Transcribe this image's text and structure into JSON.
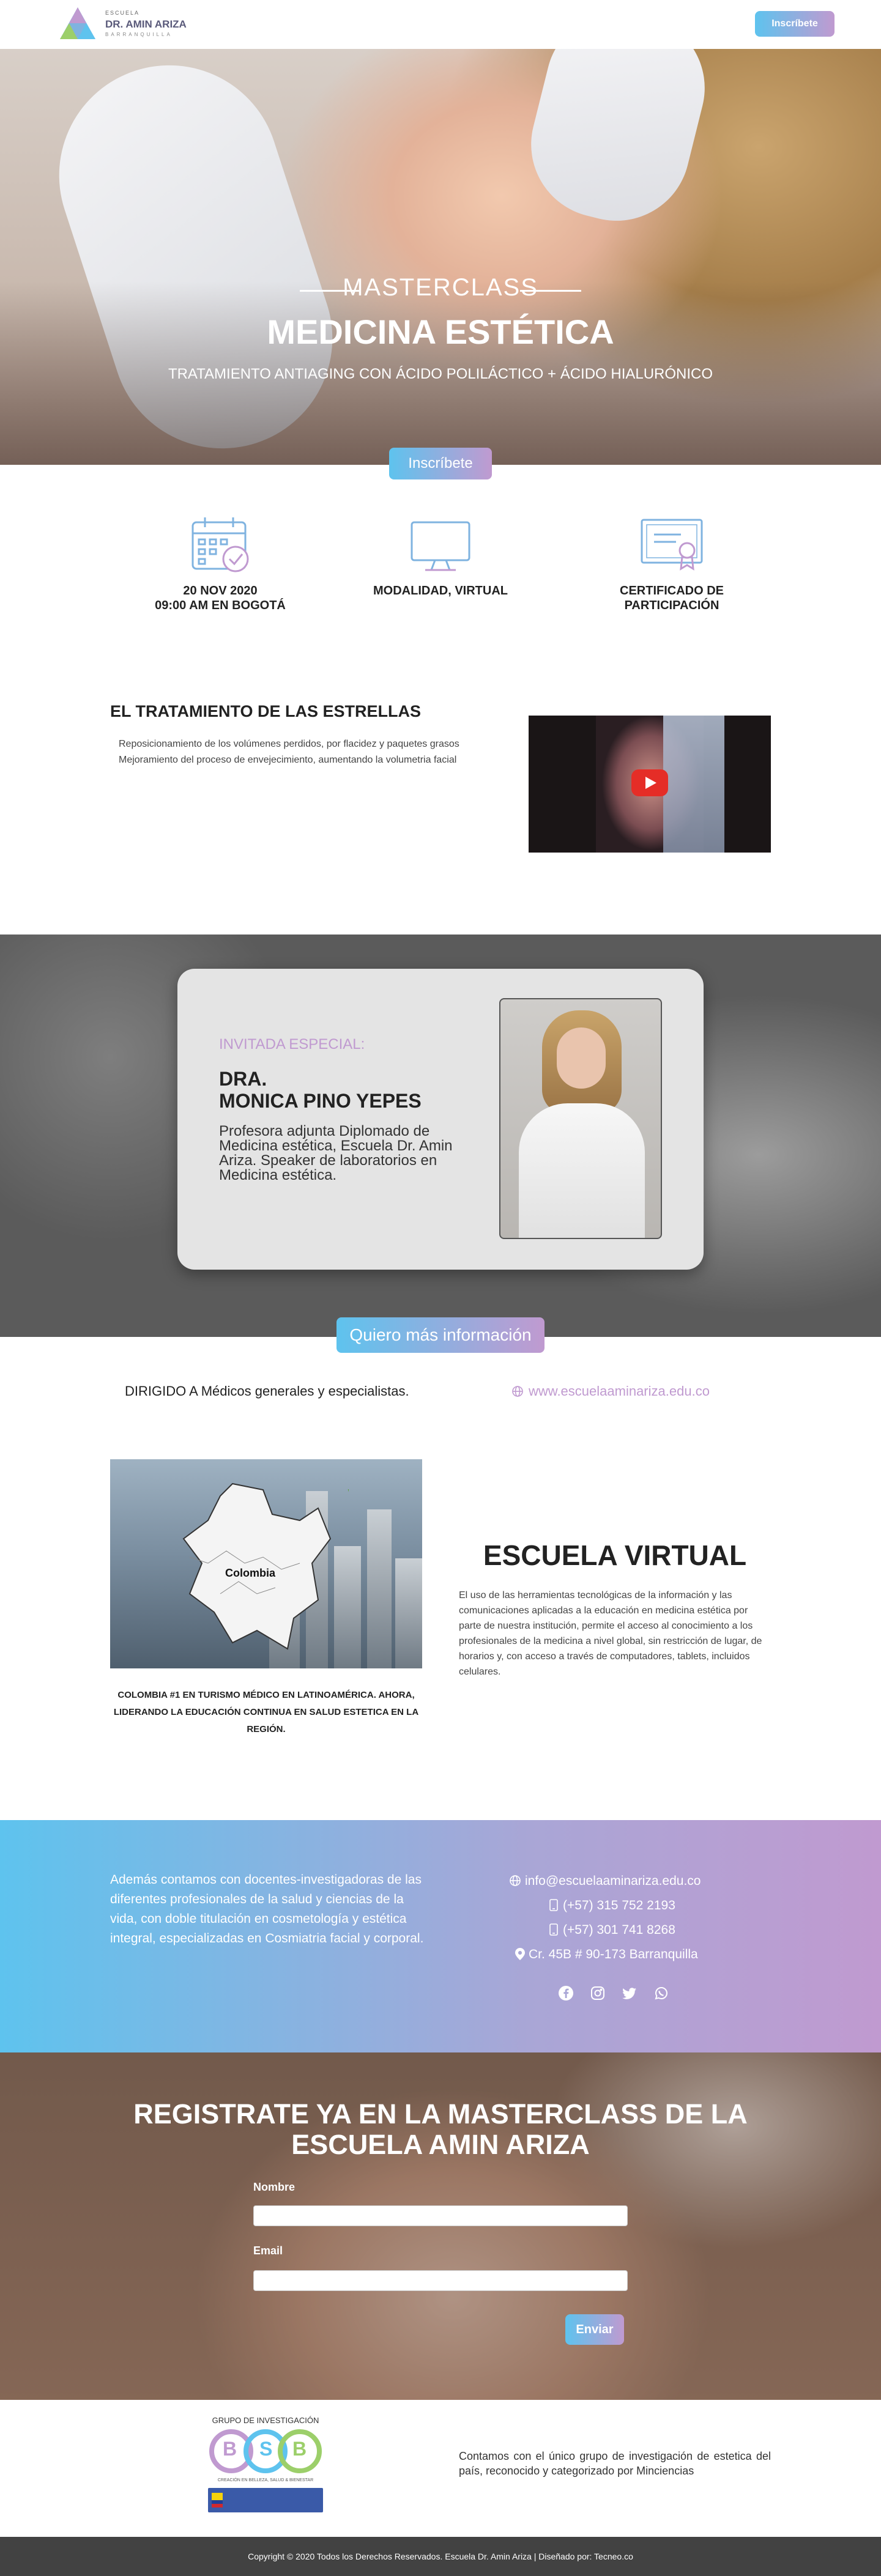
{
  "header": {
    "logo_small": "ESCUELA",
    "logo_main": "DR. AMIN ARIZA",
    "logo_city": "BARRANQUILLA",
    "cta": "Inscríbete"
  },
  "hero": {
    "kicker": "MASTERCLASS",
    "title": "MEDICINA ESTÉTICA",
    "subtitle": "TRATAMIENTO ANTIAGING CON ÁCIDO POLILÁCTICO + ÁCIDO HIALURÓNICO",
    "cta": "Inscríbete"
  },
  "features": [
    {
      "icon": "calendar-check-icon",
      "line1": "20 NOV 2020",
      "line2": "09:00 AM EN BOGOTÁ"
    },
    {
      "icon": "monitor-icon",
      "line1": "MODALIDAD, VIRTUAL",
      "line2": ""
    },
    {
      "icon": "certificate-icon",
      "line1": "CERTIFICADO DE",
      "line2": "PARTICIPACIÓN"
    }
  ],
  "treatment": {
    "title": "EL TRATAMIENTO DE LAS ESTRELLAS",
    "items": [
      "Reposicionamiento de los volúmenes perdidos, por flacidez y paquetes grasos",
      "Mejoramiento del proceso de envejecimiento, aumentando la volumetria facial"
    ]
  },
  "guest": {
    "kicker": "INVITADA ESPECIAL:",
    "name_line1": "DRA.",
    "name_line2": "MONICA PINO YEPES",
    "bio": "Profesora adjunta Diplomado de Medicina estética, Escuela Dr. Amin Ariza. Speaker de laboratorios en Medicina estética."
  },
  "info_cta": "Quiero más información",
  "aimed": "DIRIGIDO A Médicos generales y especialistas.",
  "website": "www.escuelaaminariza.edu.co",
  "virtual": {
    "map_label": "Colombia",
    "caption": "COLOMBIA #1 EN TURISMO MÉDICO EN LATINOAMÉRICA. AHORA, LIDERANDO LA EDUCACIÓN CONTINUA EN SALUD ESTETICA EN LA REGIÓN.",
    "title": "ESCUELA VIRTUAL",
    "text": "El uso de las herramientas tecnológicas de la información y las comunicaciones aplicadas a la educación en medicina estética por parte de nuestra institución, permite el acceso al conocimiento a los profesionales de la medicina a nivel global, sin restricción de lugar, de horarios y, con acceso a través de computadores, tablets, incluidos celulares."
  },
  "contact": {
    "text": "Además contamos con docentes-investigadoras de las diferentes profesionales de la salud y ciencias de la vida, con doble titulación en cosmetología y estética integral, especializadas en Cosmiatria facial y corporal.",
    "email": "info@escuelaaminariza.edu.co",
    "phone1": "(+57) 315 752 2193",
    "phone2": "(+57) 301 741 8268",
    "address": "Cr. 45B # 90-173 Barranquilla"
  },
  "register": {
    "title_line1": "REGISTRATE YA EN LA MASTERCLASS DE LA",
    "title_line2": "ESCUELA AMIN ARIZA",
    "name_label": "Nombre",
    "email_label": "Email",
    "submit": "Enviar"
  },
  "research": {
    "group_title": "GRUPO DE INVESTIGACIÓN",
    "letters": [
      "B",
      "S",
      "B"
    ],
    "tagline": "CREACIÓN EN BELLEZA, SALUD & BIENESTAR",
    "text": "Contamos con el único grupo de investigación de estetica del país, reconocido y categorizado por Minciencias"
  },
  "footer": {
    "copyright": "Copyright © 2020 Todos los Derechos Reservados. Escuela Dr. Amin Ariza | Diseñado por: Tecneo.co"
  },
  "colors": {
    "accent_blue": "#5ec3ee",
    "accent_lilac": "#c09ad0",
    "icon_stroke": "#7fb3e0",
    "footer_bg": "#424242"
  }
}
